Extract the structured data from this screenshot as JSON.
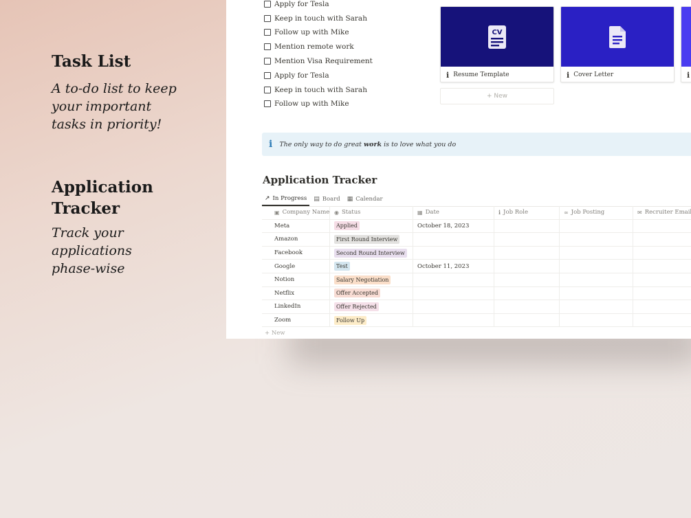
{
  "left": {
    "task_title": "Task List",
    "task_desc": [
      "A to-do list to keep",
      "your important",
      "tasks in priority!"
    ],
    "app_title": [
      "Application",
      "Tracker"
    ],
    "app_desc": [
      "Track your",
      "applications",
      "phase-wise"
    ]
  },
  "tasks": [
    "Apply for Tesla",
    "Keep in touch with Sarah",
    "Follow up with Mike",
    "Mention remote work",
    "Mention Visa Requirement",
    "Apply for Tesla",
    "Keep in touch with Sarah",
    "Follow up with Mike"
  ],
  "cards": [
    {
      "label": "Resume Template",
      "icon": "cv-document-icon",
      "color": "#16127a"
    },
    {
      "label": "Cover Letter",
      "icon": "document-icon",
      "color": "#2a20c4"
    }
  ],
  "new_label": "+ New",
  "callout": {
    "pre": "The only way to do great ",
    "bold": "work",
    "post": " is to love what you do"
  },
  "tracker": {
    "title": "Application Tracker",
    "tabs": [
      {
        "label": "In Progress",
        "icon": "arrow-up-right-icon",
        "active": true
      },
      {
        "label": "Board",
        "icon": "board-icon",
        "active": false
      },
      {
        "label": "Calendar",
        "icon": "calendar-icon",
        "active": false
      }
    ],
    "columns": [
      "Company Name",
      "Status",
      "Date",
      "Job Role",
      "Job Posting",
      "Recruiter Email"
    ],
    "rows": [
      {
        "company": "Meta",
        "status": "Applied",
        "status_color": "#f6dde6",
        "date": "October 18, 2023"
      },
      {
        "company": "Amazon",
        "status": "First Round Interview",
        "status_color": "#e3e2e0",
        "date": ""
      },
      {
        "company": "Facebook",
        "status": "Second Round Interview",
        "status_color": "#e8deee",
        "date": ""
      },
      {
        "company": "Google",
        "status": "Test",
        "status_color": "#d3e5ef",
        "date": "October 11, 2023"
      },
      {
        "company": "Notion",
        "status": "Salary Negotiation",
        "status_color": "#fadec9",
        "date": ""
      },
      {
        "company": "Netflix",
        "status": "Offer Accepted",
        "status_color": "#f8dcd4",
        "date": ""
      },
      {
        "company": "LinkedIn",
        "status": "Offer Rejected",
        "status_color": "#f5e0e9",
        "date": ""
      },
      {
        "company": "Zoom",
        "status": "Follow Up",
        "status_color": "#fdecc8",
        "date": ""
      }
    ],
    "new_label": "+ New"
  }
}
